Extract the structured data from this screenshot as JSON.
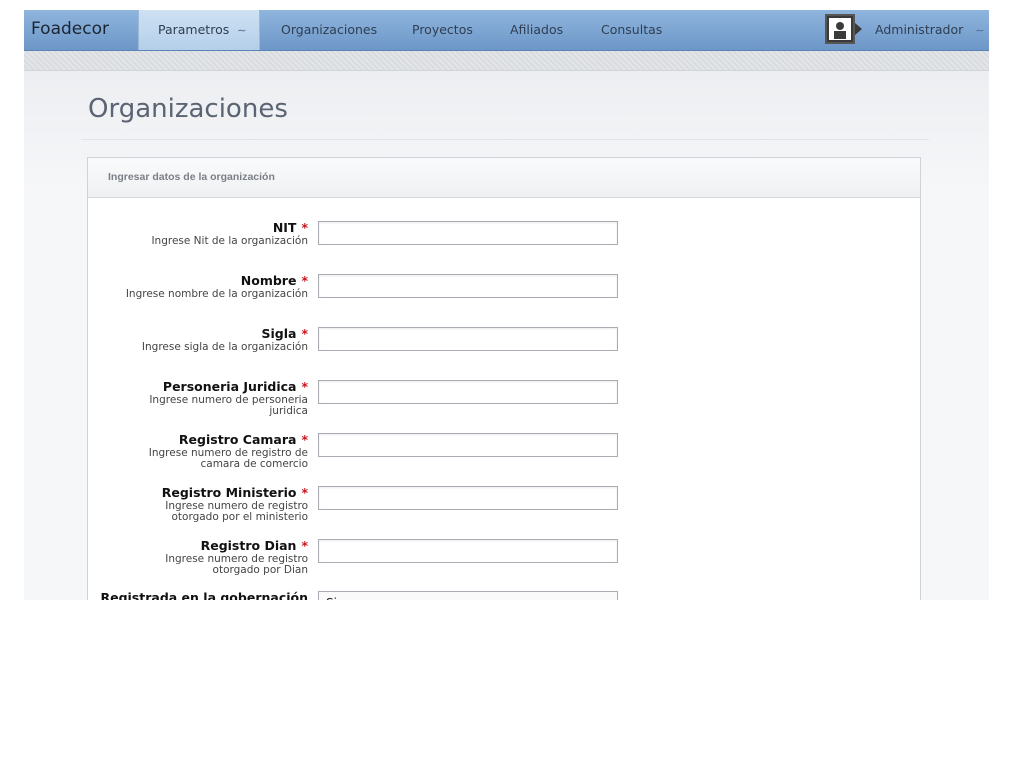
{
  "app": {
    "brand": "Foadecor"
  },
  "nav": {
    "items": [
      {
        "label": "Parametros",
        "has_chevron": true
      },
      {
        "label": "Organizaciones"
      },
      {
        "label": "Proyectos"
      },
      {
        "label": "Afiliados"
      },
      {
        "label": "Consultas"
      }
    ],
    "user": {
      "label": "Administrador"
    }
  },
  "page": {
    "title": "Organizaciones"
  },
  "panel": {
    "title": "Ingresar datos de la organización"
  },
  "form": {
    "fields": [
      {
        "label": "NIT",
        "required": "*",
        "help_lines": [
          "Ingrese Nit de la organización"
        ],
        "value": ""
      },
      {
        "label": "Nombre",
        "required": "*",
        "help_lines": [
          "Ingrese nombre de la organización"
        ],
        "value": ""
      },
      {
        "label": "Sigla",
        "required": "*",
        "help_lines": [
          "Ingrese sigla de la organización"
        ],
        "value": ""
      },
      {
        "label": "Personeria Juridica",
        "required": "*",
        "help_lines": [
          "Ingrese numero de personeria",
          "juridica"
        ],
        "value": ""
      },
      {
        "label": "Registro Camara",
        "required": "*",
        "help_lines": [
          "Ingrese numero de registro de",
          "camara de comercio"
        ],
        "value": ""
      },
      {
        "label": "Registro Ministerio",
        "required": "*",
        "help_lines": [
          "Ingrese numero de registro",
          "otorgado por el ministerio"
        ],
        "value": ""
      },
      {
        "label": "Registro Dian",
        "required": "*",
        "help_lines": [
          "Ingrese numero de registro",
          "otorgado por Dian"
        ],
        "value": ""
      }
    ],
    "gobernacion": {
      "label": "Registrada en la gobernación",
      "selected": "Si"
    }
  },
  "colors": {
    "nav_top": "#8fb5dd",
    "nav_bottom": "#6d97c8",
    "required": "#c8141c",
    "title": "#5b6472"
  },
  "icons": {
    "user": "user-avatar-icon",
    "chevron": "chevron-down-icon"
  }
}
